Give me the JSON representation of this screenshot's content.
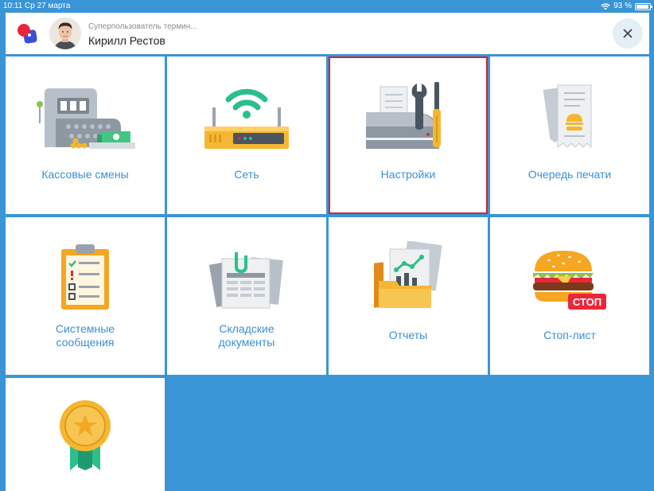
{
  "status": {
    "time_date": "10:11  Ср 27 марта",
    "battery": "93 %",
    "battery_level": 0.93
  },
  "header": {
    "role": "Суперпользователь термин...",
    "name": "Кирилл Рестов"
  },
  "tiles": [
    {
      "label": "Кассовые смены"
    },
    {
      "label": "Сеть"
    },
    {
      "label": "Настройки"
    },
    {
      "label": "Очередь печати"
    },
    {
      "label": "Системные\nсообщения"
    },
    {
      "label": "Складские\nдокументы"
    },
    {
      "label": "Отчеты"
    },
    {
      "label": "Стоп-лист"
    }
  ],
  "stop_badge": "СТОП",
  "colors": {
    "background": "#3a95d6",
    "label": "#3a8fd3",
    "selected_border": "#d32331"
  }
}
